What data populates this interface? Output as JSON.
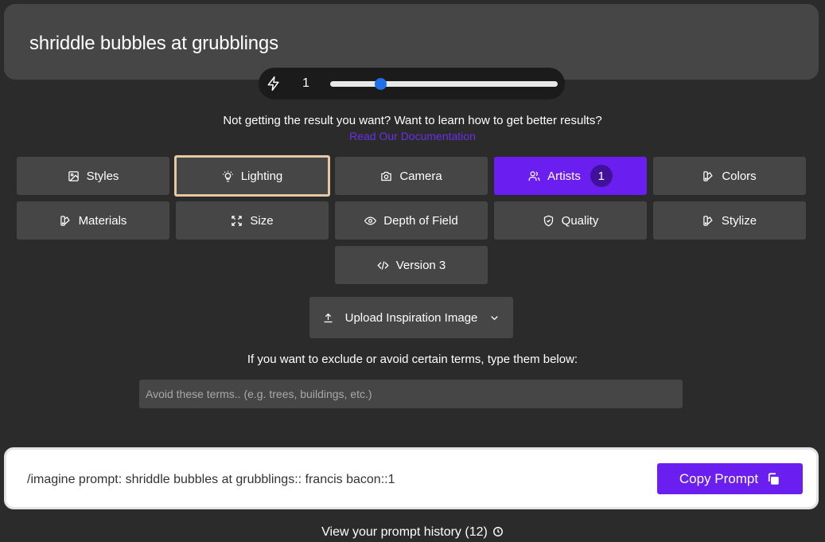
{
  "prompt": {
    "text": "shriddle bubbles at grubblings"
  },
  "weight": {
    "value": "1",
    "fraction": 0.22
  },
  "help": {
    "text": "Not getting the result you want? Want to learn how to get better results?",
    "link": "Read Our Documentation"
  },
  "options": [
    {
      "label": "Styles",
      "icon": "image-icon"
    },
    {
      "label": "Lighting",
      "icon": "lightbulb-icon"
    },
    {
      "label": "Camera",
      "icon": "camera-icon"
    },
    {
      "label": "Artists",
      "icon": "users-icon",
      "badge": "1"
    },
    {
      "label": "Colors",
      "icon": "palette-icon"
    },
    {
      "label": "Materials",
      "icon": "palette-icon"
    },
    {
      "label": "Size",
      "icon": "expand-icon"
    },
    {
      "label": "Depth of Field",
      "icon": "eye-icon"
    },
    {
      "label": "Quality",
      "icon": "shield-check-icon"
    },
    {
      "label": "Stylize",
      "icon": "palette-icon"
    },
    {
      "label": "Version 3",
      "icon": "code-icon"
    }
  ],
  "upload": {
    "label": "Upload Inspiration Image"
  },
  "exclude": {
    "label": "If you want to exclude or avoid certain terms, type them below:",
    "placeholder": "Avoid these terms.. (e.g. trees, buildings, etc.)",
    "value": ""
  },
  "output": {
    "text": "/imagine prompt: shriddle bubbles at grubblings:: francis bacon::1",
    "copy_label": "Copy Prompt"
  },
  "history": {
    "label": "View your prompt history (12)"
  },
  "colors": {
    "accent": "#6a1ff0",
    "panel": "#464646",
    "background": "#2b2b2b",
    "focus": "#e6c9a3"
  }
}
